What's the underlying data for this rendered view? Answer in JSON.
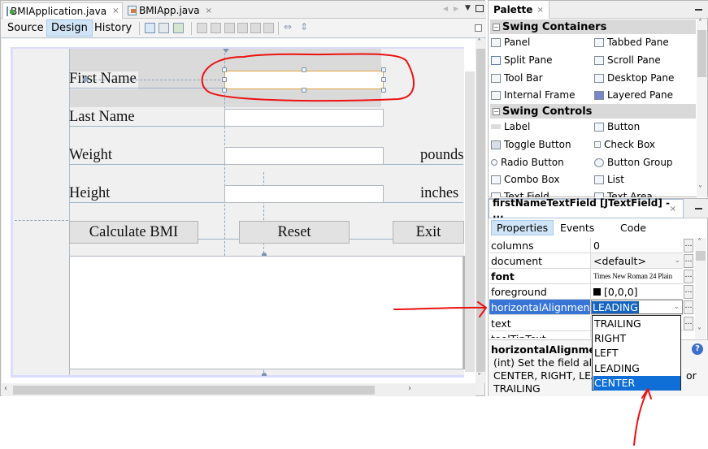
{
  "editor": {
    "tabs": [
      {
        "label": "BMIApplication.java",
        "active": true
      },
      {
        "label": "BMIApp.java",
        "active": false
      }
    ],
    "close_glyph": "×",
    "view_buttons": [
      {
        "label": "Source",
        "selected": false
      },
      {
        "label": "Design",
        "selected": true
      },
      {
        "label": "History",
        "selected": false
      }
    ],
    "toolbar_icons": [
      "selection-mode-icon",
      "connection-mode-icon",
      "preview-design-icon",
      "align-left-icon",
      "align-right-icon",
      "center-horizontal-icon",
      "align-top-icon",
      "align-bottom-icon",
      "center-vertical-icon",
      "resize-horizontal-icon",
      "resize-vertical-icon"
    ],
    "nav_glyphs": {
      "left": "◀",
      "right": "▶",
      "menu": "▼",
      "maximize": "□"
    }
  },
  "form": {
    "labels": {
      "first_name": "First Name",
      "last_name": "Last Name",
      "weight": "Weight",
      "height": "Height",
      "pounds": "pounds",
      "inches": "inches"
    },
    "fields": {
      "first_name": "",
      "last_name": "",
      "weight": "",
      "height": ""
    },
    "buttons": {
      "calculate": "Calculate BMI",
      "reset": "Reset",
      "exit": "Exit"
    },
    "output_text": ""
  },
  "palette": {
    "title": "Palette",
    "categories": [
      {
        "name": "Swing Containers",
        "items": [
          "Panel",
          "Tabbed Pane",
          "Split Pane",
          "Scroll Pane",
          "Tool Bar",
          "Desktop Pane",
          "Internal Frame",
          "Layered Pane"
        ]
      },
      {
        "name": "Swing Controls",
        "items": [
          "Label",
          "Button",
          "Toggle Button",
          "Check Box",
          "Radio Button",
          "Button Group",
          "Combo Box",
          "List",
          "Text Field",
          "Text Area"
        ]
      }
    ]
  },
  "properties": {
    "title": "firstNameTextField [JTextField] - ...",
    "tabs": [
      {
        "label": "Properties",
        "selected": true
      },
      {
        "label": "Events",
        "selected": false
      },
      {
        "label": "Code",
        "selected": false
      }
    ],
    "rows": [
      {
        "name": "columns",
        "value": "0",
        "bold": false
      },
      {
        "name": "document",
        "value": "<default>",
        "bold": false
      },
      {
        "name": "font",
        "value": "Times New Roman 24 Plain",
        "bold": true
      },
      {
        "name": "foreground",
        "value": "[0,0,0]",
        "bold": false
      },
      {
        "name": "horizontalAlignment",
        "value": "LEADING",
        "bold": false,
        "selected": true
      },
      {
        "name": "text",
        "value": "",
        "bold": false
      },
      {
        "name": "toolTipText",
        "value": "",
        "bold": false
      }
    ],
    "dropdown_options": [
      "TRAILING",
      "RIGHT",
      "LEFT",
      "LEADING",
      "CENTER"
    ],
    "dropdown_highlighted": "CENTER",
    "description": {
      "title": "horizontalAlignment",
      "line1": "(int) Set the field align",
      "line2": "CENTER, RIGHT, LEA",
      "line2_tail": "or",
      "line3": "TRAILING"
    },
    "foreground_color": "#000000",
    "selection_color": "#3875d7"
  },
  "annotations": {
    "color": "#ee1111"
  }
}
